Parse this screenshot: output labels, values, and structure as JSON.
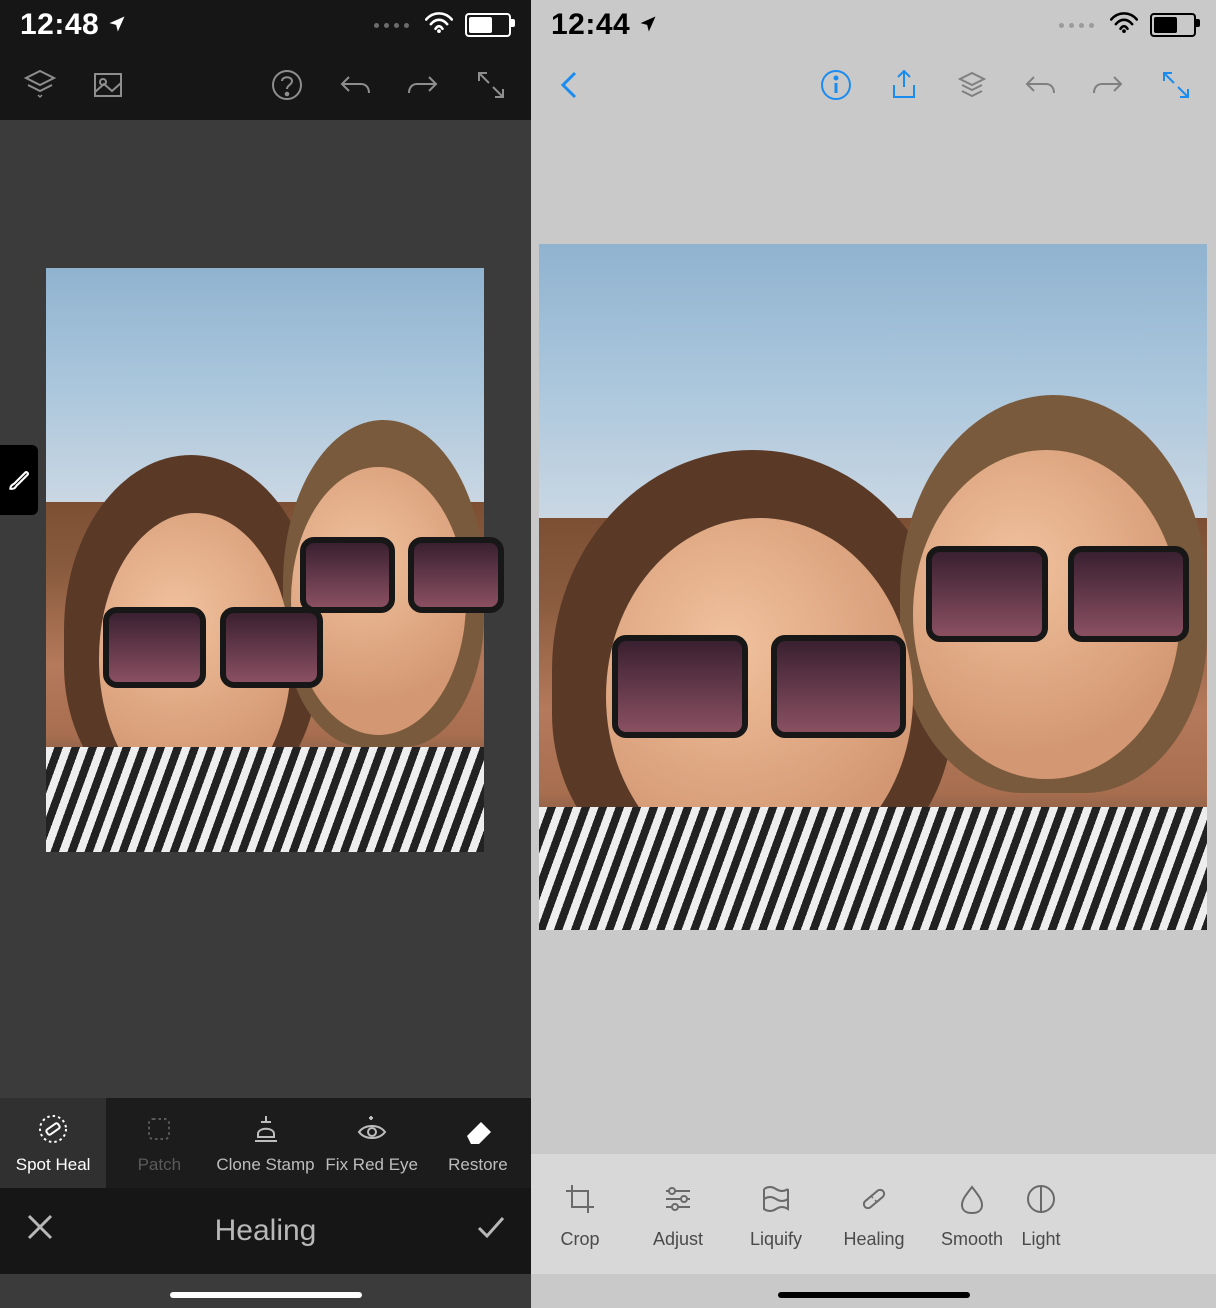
{
  "left": {
    "status": {
      "time": "12:48"
    },
    "toolbar_left": [
      "layers-icon",
      "image-icon"
    ],
    "toolbar_right": [
      "help-icon",
      "undo-icon",
      "redo-icon",
      "fullscreen-icon"
    ],
    "side_tool": "brush-icon",
    "tools": [
      {
        "name": "spot-heal",
        "label": "Spot Heal",
        "selected": true
      },
      {
        "name": "patch",
        "label": "Patch",
        "dim": true
      },
      {
        "name": "clone-stamp",
        "label": "Clone Stamp"
      },
      {
        "name": "fix-red-eye",
        "label": "Fix Red Eye"
      },
      {
        "name": "restore",
        "label": "Restore"
      }
    ],
    "mode_title": "Healing"
  },
  "right": {
    "status": {
      "time": "12:44"
    },
    "toolbar_left": [
      "back-icon"
    ],
    "toolbar_right": [
      "info-icon",
      "share-icon",
      "layers-icon",
      "undo-icon",
      "redo-icon",
      "fullscreen-icon"
    ],
    "tools": [
      {
        "name": "crop",
        "label": "Crop"
      },
      {
        "name": "adjust",
        "label": "Adjust"
      },
      {
        "name": "liquify",
        "label": "Liquify"
      },
      {
        "name": "healing",
        "label": "Healing"
      },
      {
        "name": "smooth",
        "label": "Smooth"
      },
      {
        "name": "light",
        "label": "Light",
        "cut": true
      }
    ]
  }
}
